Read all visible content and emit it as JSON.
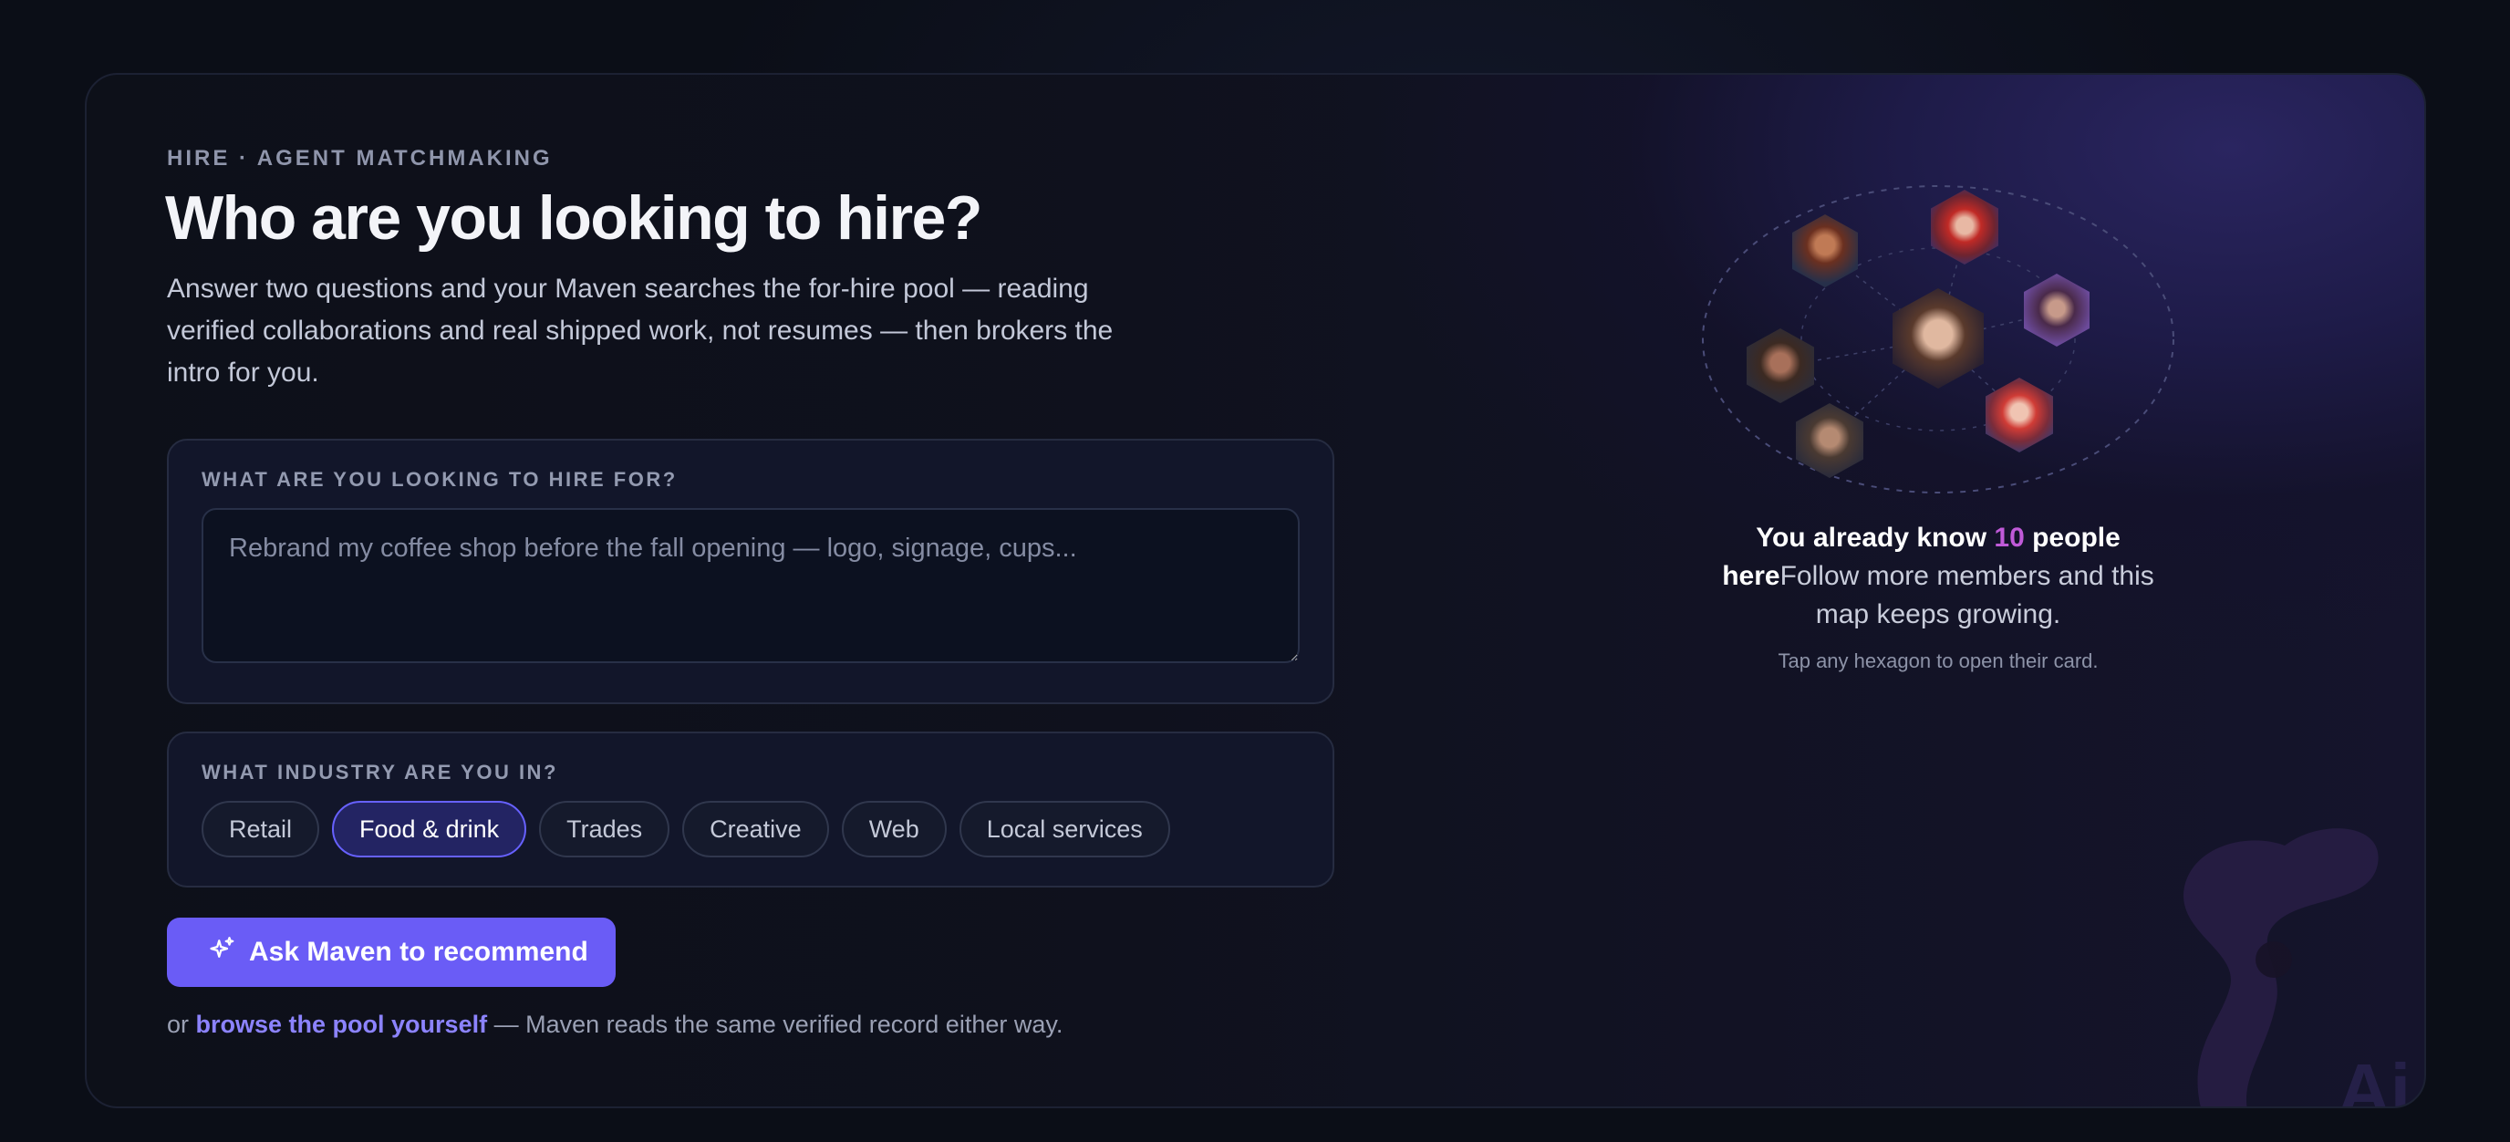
{
  "header": {
    "eyebrow": "HIRE · AGENT MATCHMAKING",
    "title": "Who are you looking to hire?",
    "subtitle": "Answer two questions and your Maven searches the for-hire pool — reading verified collaborations and real shipped work, not resumes — then brokers the intro for you."
  },
  "hire_for": {
    "label": "WHAT ARE YOU LOOKING TO HIRE FOR?",
    "placeholder": "Rebrand my coffee shop before the fall opening — logo, signage, cups...",
    "value": ""
  },
  "industry": {
    "label": "WHAT INDUSTRY ARE YOU IN?",
    "options": [
      "Retail",
      "Food & drink",
      "Trades",
      "Creative",
      "Web",
      "Local services"
    ],
    "selected": "Food & drink"
  },
  "cta": {
    "label": "Ask Maven to recommend",
    "icon": "sparkle-icon"
  },
  "footnote": {
    "prefix": "or",
    "link": "browse the pool yourself",
    "suffix": "— Maven reads the same verified record either way."
  },
  "network": {
    "bold_prefix": "You already know",
    "count": "10",
    "bold_suffix": "people here",
    "rest": "Follow more members and this map keeps growing.",
    "hint": "Tap any hexagon to open their card.",
    "member_avatars": 8
  },
  "colors": {
    "accent": "#6a5cf6",
    "accent_link": "#8c83ff",
    "count_highlight": "#c05ad8",
    "background": "#0b0e17"
  }
}
